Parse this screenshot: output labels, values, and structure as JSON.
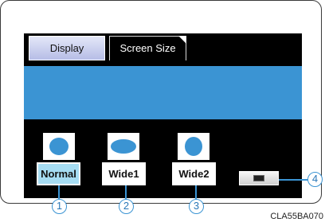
{
  "tabs": {
    "display_label": "Display",
    "screen_size_label": "Screen Size"
  },
  "modes": {
    "normal": {
      "label": "Normal",
      "icon": "aspect-normal-icon",
      "selected": true
    },
    "wide1": {
      "label": "Wide1",
      "icon": "aspect-wide1-icon",
      "selected": false
    },
    "wide2": {
      "label": "Wide2",
      "icon": "aspect-wide2-icon",
      "selected": false
    }
  },
  "extra_button_icon": "screen-off-icon",
  "callouts": [
    "1",
    "2",
    "3",
    "4"
  ],
  "figure_code": "CLA55BA070",
  "colors": {
    "screen_bg": "#000000",
    "banner": "#3b94d3",
    "selected_button": "#a6dcf2",
    "callout": "#3b94d3"
  }
}
